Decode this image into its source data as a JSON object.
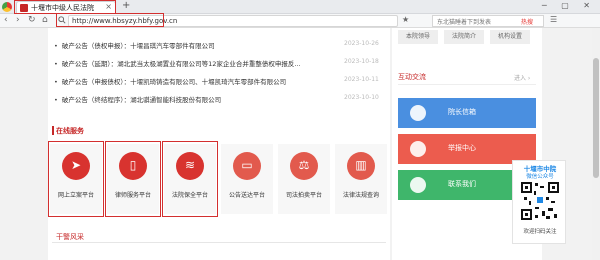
{
  "browser": {
    "tab_title": "十堰市中级人民法院",
    "tab_close": "×",
    "new_tab": "+",
    "url": "http://www.hbsyzy.hbfy.gov.cn",
    "search_placeholder": "东北猫睡着下到发表",
    "search_hot": "热搜",
    "window_controls": "─ ▢ ✕"
  },
  "news": [
    {
      "title": "破产公告（债权申报）：十堰昌琪汽车零部件有限公司",
      "date": "2023-10-26"
    },
    {
      "title": "破产公告（延期）：湖北武当太极湖置业有限公司等12家企业合并重整债权申报反...",
      "date": "2023-10-18"
    },
    {
      "title": "破产公告（申报债权）：十堰凯琦铸造有限公司、十堰凯琦汽车零部件有限公司",
      "date": "2023-10-11"
    },
    {
      "title": "破产公告（终结程序）：湖北骐通智能科技股份有限公司",
      "date": "2023-10-10"
    }
  ],
  "online_services": {
    "title": "在线服务",
    "items": [
      {
        "label": "网上立案平台",
        "icon": "compass-icon"
      },
      {
        "label": "律师服务平台",
        "icon": "phone-icon"
      },
      {
        "label": "法院保全平台",
        "icon": "layers-icon"
      },
      {
        "label": "公告送达平台",
        "icon": "chat-icon"
      },
      {
        "label": "司法拍卖平台",
        "icon": "auction-icon"
      },
      {
        "label": "法律法规查询",
        "icon": "books-icon"
      }
    ]
  },
  "lower_section": {
    "title": "干警风采"
  },
  "right_panel": {
    "top_buttons": [
      "本院领导",
      "法院简介",
      "机构设置"
    ],
    "interact_title": "互动交流",
    "interact_more": "进入 ›",
    "cards": [
      {
        "label": "院长信箱",
        "color": "#4a8fe0"
      },
      {
        "label": "举报中心",
        "color": "#ec5c4e"
      },
      {
        "label": "联系我们",
        "color": "#3fb66b"
      }
    ]
  },
  "qr": {
    "title": "十堰市中院",
    "subtitle": "微信公众号",
    "footer": "欢迎扫码关注"
  }
}
